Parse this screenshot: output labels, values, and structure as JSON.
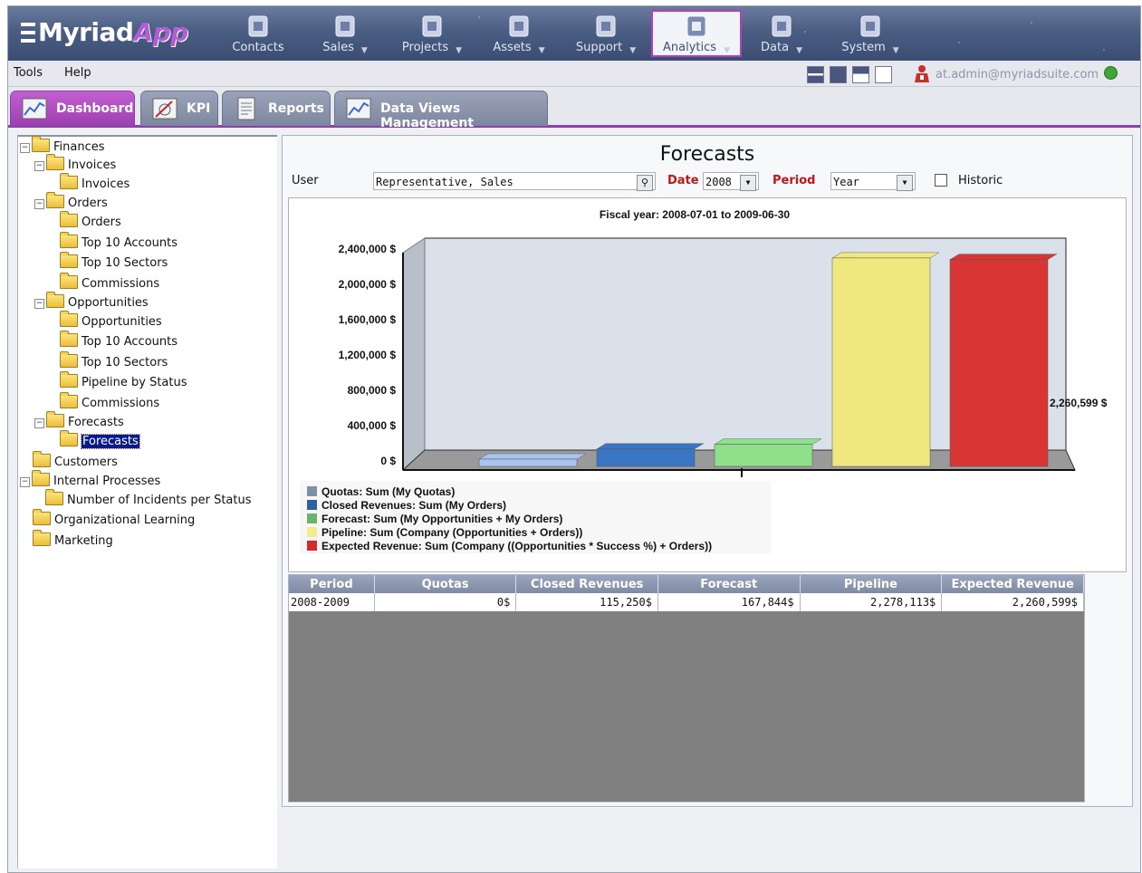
{
  "app": {
    "logo_main": "Myriad",
    "logo_accent": "App",
    "modules": [
      {
        "label": "Contacts",
        "icon": "contacts-icon",
        "has_menu": false
      },
      {
        "label": "Sales",
        "icon": "sales-icon",
        "has_menu": true
      },
      {
        "label": "Projects",
        "icon": "projects-icon",
        "has_menu": true
      },
      {
        "label": "Assets",
        "icon": "assets-icon",
        "has_menu": true
      },
      {
        "label": "Support",
        "icon": "support-icon",
        "has_menu": true
      },
      {
        "label": "Analytics",
        "icon": "analytics-icon",
        "has_menu": true,
        "active": true
      },
      {
        "label": "Data",
        "icon": "data-icon",
        "has_menu": true
      },
      {
        "label": "System",
        "icon": "system-icon",
        "has_menu": true
      }
    ]
  },
  "menubar": {
    "tools": "Tools",
    "help": "Help",
    "user_email": "at.admin@myriadsuite.com",
    "status_color": "#3fa53a"
  },
  "tabs": [
    {
      "label": "Dashboard",
      "active": true,
      "icon": "dashboard-icon"
    },
    {
      "label": "KPI",
      "active": false,
      "icon": "kpi-icon"
    },
    {
      "label": "Reports",
      "active": false,
      "icon": "reports-icon"
    },
    {
      "label": "Data Views Management",
      "active": false,
      "icon": "data-views-icon"
    }
  ],
  "tree": [
    {
      "label": "Finances",
      "expanded": true
    },
    {
      "label": "Invoices",
      "expanded": true
    },
    {
      "label": "Invoices"
    },
    {
      "label": "Orders",
      "expanded": true
    },
    {
      "label": "Orders"
    },
    {
      "label": "Top 10 Accounts"
    },
    {
      "label": "Top 10 Sectors"
    },
    {
      "label": "Commissions"
    },
    {
      "label": "Opportunities",
      "expanded": true
    },
    {
      "label": "Opportunities"
    },
    {
      "label": "Top 10 Accounts"
    },
    {
      "label": "Top 10 Sectors"
    },
    {
      "label": "Pipeline by Status"
    },
    {
      "label": "Commissions"
    },
    {
      "label": "Forecasts",
      "expanded": true
    },
    {
      "label": "Forecasts",
      "selected": true
    },
    {
      "label": "Customers"
    },
    {
      "label": "Internal Processes",
      "expanded": true
    },
    {
      "label": "Number of Incidents per Status"
    },
    {
      "label": "Organizational Learning"
    },
    {
      "label": "Marketing"
    }
  ],
  "report": {
    "title": "Forecasts",
    "user_label": "User",
    "user_value": "Representative, Sales",
    "date_label": "Date",
    "date_value": "2008",
    "period_label": "Period",
    "period_value": "Year",
    "historic_label": "Historic",
    "historic_checked": false
  },
  "chart_data": {
    "type": "bar",
    "title": "Fiscal year: 2008-07-01 to 2009-06-30",
    "categories": [
      "2008-2009"
    ],
    "y_ticks": [
      "0 $",
      "400,000 $",
      "800,000 $",
      "1,200,000 $",
      "1,600,000 $",
      "2,000,000 $",
      "2,400,000 $"
    ],
    "ylim": [
      0,
      2400000
    ],
    "series": [
      {
        "name": "Quotas: Sum (My Quotas)",
        "values": [
          0
        ],
        "color": "#a9c4f0"
      },
      {
        "name": "Closed Revenues: Sum (My Orders)",
        "values": [
          115250
        ],
        "color": "#3a75c4"
      },
      {
        "name": "Forecast: Sum (My Opportunities + My Orders)",
        "values": [
          167844
        ],
        "color": "#8fe08a"
      },
      {
        "name": "Pipeline: Sum (Company (Opportunities + Orders))",
        "values": [
          2278113
        ],
        "color": "#f1e77f"
      },
      {
        "name": "Expected Revenue: Sum (Company ((Opportunities * Success %) + Orders))",
        "values": [
          2260599
        ],
        "color": "#d93535"
      }
    ],
    "legend_colors": [
      "#7f8fa8",
      "#2d5fa3",
      "#6bb46a",
      "#f2ec90",
      "#d42c2c"
    ],
    "data_label": "2,260,599 $",
    "legend_position": "bottom-left",
    "grid": false
  },
  "table": {
    "columns": [
      "Period",
      "Quotas",
      "Closed Revenues",
      "Forecast",
      "Pipeline",
      "Expected Revenue"
    ],
    "rows": [
      [
        "2008-2009",
        "0$",
        "115,250$",
        "167,844$",
        "2,278,113$",
        "2,260,599$"
      ]
    ]
  }
}
